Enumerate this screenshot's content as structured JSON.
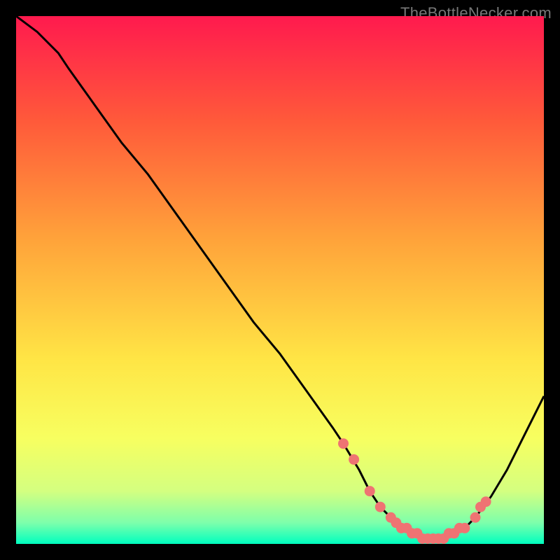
{
  "watermark": "TheBottleNecker.com",
  "colors": {
    "bg_black": "#000000",
    "gradient_stops": [
      {
        "offset": 0.0,
        "color": "#ff1a4e"
      },
      {
        "offset": 0.2,
        "color": "#ff5a3a"
      },
      {
        "offset": 0.42,
        "color": "#ffa23a"
      },
      {
        "offset": 0.65,
        "color": "#ffe545"
      },
      {
        "offset": 0.8,
        "color": "#f7ff60"
      },
      {
        "offset": 0.9,
        "color": "#d4ff80"
      },
      {
        "offset": 0.96,
        "color": "#7dffab"
      },
      {
        "offset": 1.0,
        "color": "#00ffbf"
      }
    ],
    "curve": "#000000",
    "marker_fill": "#ef7373",
    "marker_stroke": "#ef7373"
  },
  "chart_data": {
    "type": "line",
    "title": "",
    "xlabel": "",
    "ylabel": "",
    "xlim": [
      0,
      100
    ],
    "ylim": [
      0,
      100
    ],
    "legend": false,
    "grid": false,
    "series": [
      {
        "name": "bottleneck-curve",
        "x": [
          0,
          4,
          8,
          10,
          15,
          20,
          25,
          30,
          35,
          40,
          45,
          50,
          55,
          60,
          62,
          65,
          67,
          69,
          71,
          73,
          75,
          77,
          79,
          81,
          83,
          85,
          87,
          90,
          93,
          96,
          100
        ],
        "y": [
          100,
          97,
          93,
          90,
          83,
          76,
          70,
          63,
          56,
          49,
          42,
          36,
          29,
          22,
          19,
          14,
          10,
          7,
          5,
          3,
          2,
          1,
          1,
          1,
          2,
          3,
          5,
          9,
          14,
          20,
          28
        ]
      }
    ],
    "markers": {
      "name": "highlighted-points",
      "x": [
        62,
        64,
        67,
        69,
        71,
        72,
        73,
        74,
        75,
        76,
        77,
        78,
        79,
        80,
        81,
        82,
        83,
        84,
        85,
        87,
        88,
        89
      ],
      "y": [
        19,
        16,
        10,
        7,
        5,
        4,
        3,
        3,
        2,
        2,
        1,
        1,
        1,
        1,
        1,
        2,
        2,
        3,
        3,
        5,
        7,
        8
      ]
    }
  }
}
